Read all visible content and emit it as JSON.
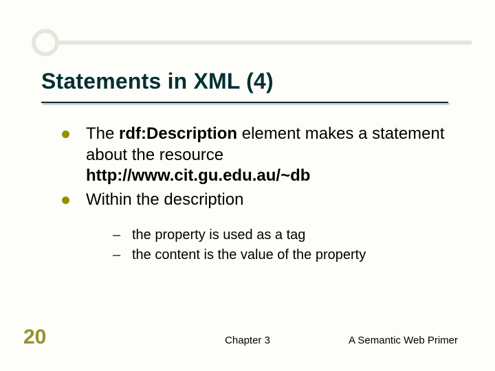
{
  "slide": {
    "title": "Statements in XML (4)",
    "bullets": [
      {
        "prefix": "The ",
        "bold1": "rdf:Description",
        "mid": " element makes a statement about the resource ",
        "bold2": "http://www.cit.gu.edu.au/~db"
      },
      {
        "text": "Within the description"
      }
    ],
    "subbullets": [
      "the property is used as a tag",
      "the content is the value of the property"
    ]
  },
  "footer": {
    "page_number": "20",
    "center": "Chapter 3",
    "right": "A Semantic Web Primer"
  },
  "colors": {
    "accent_dark": "#003030",
    "accent_olive": "#929200",
    "deco_light": "#e6e6dd"
  }
}
